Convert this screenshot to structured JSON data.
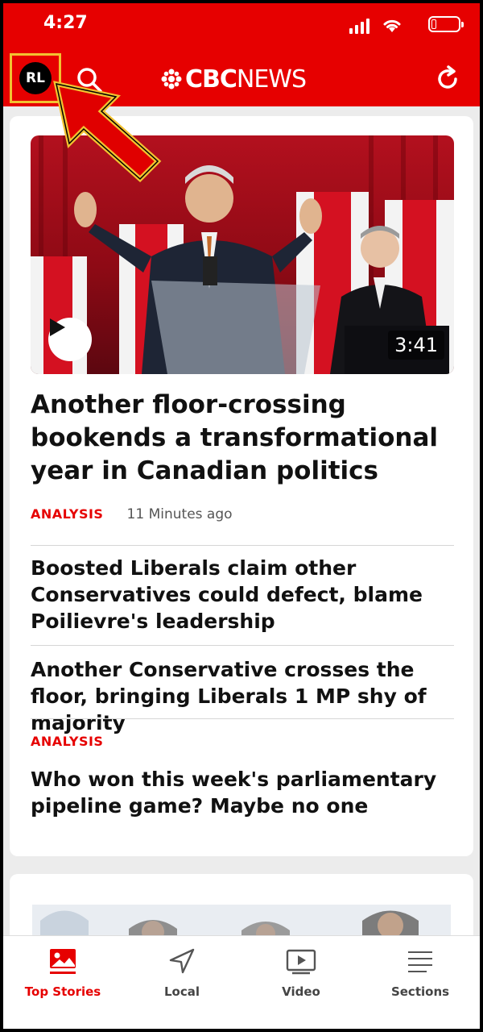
{
  "status_bar": {
    "time": "4:27"
  },
  "header": {
    "avatar_initials": "RL",
    "logo_cbc": "CBC",
    "logo_news": "NEWS"
  },
  "lead_story": {
    "video_duration": "3:41",
    "headline": "Another floor-crossing bookends a transformational year in Canadian politics",
    "tag": "ANALYSIS",
    "time": "11 Minutes ago"
  },
  "related_stories": [
    {
      "headline": "Boosted Liberals claim other Conservatives could defect, blame Poilievre's leadership"
    },
    {
      "headline": "Another Conservative crosses the floor, bringing Liberals 1 MP shy of majority"
    },
    {
      "tag": "ANALYSIS",
      "headline": "Who won this week's parliamentary pipeline game? Maybe no one"
    }
  ],
  "bottom_nav": [
    {
      "label": "Top Stories",
      "icon": "photo-icon",
      "active": true
    },
    {
      "label": "Local",
      "icon": "location-arrow-icon"
    },
    {
      "label": "Video",
      "icon": "video-play-icon"
    },
    {
      "label": "Sections",
      "icon": "menu-lines-icon"
    }
  ],
  "colors": {
    "brand_red": "#e60000",
    "highlight_yellow": "#f2c230"
  }
}
